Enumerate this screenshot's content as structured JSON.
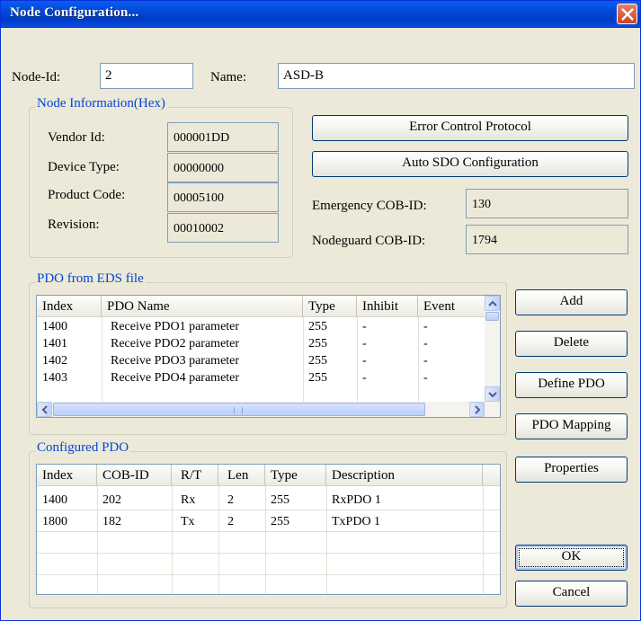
{
  "window": {
    "title": "Node Configuration..."
  },
  "node": {
    "id_label": "Node-Id:",
    "id_value": "2",
    "name_label": "Name:",
    "name_value": "ASD-B"
  },
  "node_info": {
    "legend": "Node Information(Hex)",
    "vendor_label": "Vendor Id:",
    "vendor_value": "000001DD",
    "device_label": "Device Type:",
    "device_value": "00000000",
    "product_label": "Product Code:",
    "product_value": "00005100",
    "revision_label": "Revision:",
    "revision_value": "00010002"
  },
  "protocol": {
    "error_control_label": "Error Control Protocol",
    "auto_sdo_label": "Auto SDO Configuration",
    "emergency_label": "Emergency COB-ID:",
    "emergency_value": "130",
    "nodeguard_label": "Nodeguard COB-ID:",
    "nodeguard_value": "1794"
  },
  "pdo_eds": {
    "legend": "PDO from EDS file",
    "headers": [
      "Index",
      "PDO Name",
      "Type",
      "Inhibit",
      "Event"
    ],
    "rows": [
      [
        "1400",
        "Receive PDO1 parameter",
        "255",
        "-",
        "-"
      ],
      [
        "1401",
        "Receive PDO2 parameter",
        "255",
        "-",
        "-"
      ],
      [
        "1402",
        "Receive PDO3 parameter",
        "255",
        "-",
        "-"
      ],
      [
        "1403",
        "Receive PDO4 parameter",
        "255",
        "-",
        "-"
      ]
    ]
  },
  "configured_pdo": {
    "legend": "Configured PDO",
    "headers": [
      "Index",
      "COB-ID",
      "R/T",
      "Len",
      "Type",
      "Description"
    ],
    "rows": [
      [
        "1400",
        "202",
        "Rx",
        "2",
        "255",
        "RxPDO 1"
      ],
      [
        "1800",
        "182",
        "Tx",
        "2",
        "255",
        "TxPDO 1"
      ]
    ]
  },
  "buttons": {
    "add": "Add",
    "delete": "Delete",
    "define_pdo": "Define PDO",
    "pdo_mapping": "PDO Mapping",
    "properties": "Properties",
    "ok": "OK",
    "cancel": "Cancel"
  },
  "colors": {
    "titlebar": "#0249d6",
    "legend_text": "#0046d5",
    "dialog_bg": "#ece9d8"
  }
}
